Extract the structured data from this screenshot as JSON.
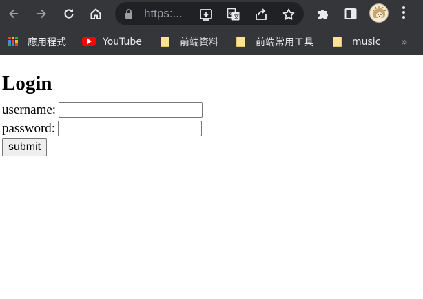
{
  "browser": {
    "url_display": "https:...",
    "bookmarks": [
      {
        "label": "應用程式",
        "icon": "apps-grid-icon"
      },
      {
        "label": "YouTube",
        "icon": "youtube-icon"
      },
      {
        "label": "前端資料",
        "icon": "folder-icon"
      },
      {
        "label": "前端常用工具",
        "icon": "folder-icon"
      },
      {
        "label": "music",
        "icon": "folder-icon"
      }
    ],
    "more_bookmarks_glyph": "»"
  },
  "page": {
    "title": "Login",
    "username_label": "username:",
    "username_value": "",
    "password_label": "password:",
    "password_value": "",
    "submit_label": "submit"
  },
  "colors": {
    "chrome_bg": "#35363a",
    "omnibox_bg": "#202124",
    "icon_light": "#e8eaed",
    "icon_dim": "#9aa0a6",
    "folder_yellow": "#fde293",
    "youtube_red": "#ff0000"
  }
}
